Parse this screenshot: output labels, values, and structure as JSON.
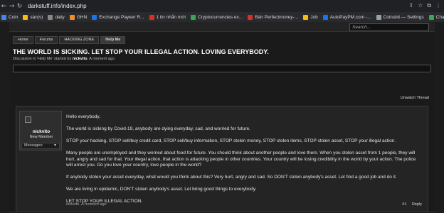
{
  "browser": {
    "url": "darkstuff.info/index.php",
    "bookmarks": [
      {
        "label": "Coin",
        "color": "#4285f4"
      },
      {
        "label": "sàn(v)",
        "color": "#fbbc04"
      },
      {
        "label": "daily",
        "color": "#888888"
      },
      {
        "label": "GHN",
        "color": "#f28c28"
      },
      {
        "label": "Exchange Payeer R...",
        "color": "#1a73e8"
      },
      {
        "label": "1 tin nhắn mới",
        "color": "#d93025"
      },
      {
        "label": "Cryptocurrencies ex...",
        "color": "#34a853"
      },
      {
        "label": "Bán Perfectmoney-...",
        "color": "#d93025"
      },
      {
        "label": "Job",
        "color": "#fbbc04"
      },
      {
        "label": "AutoPayPM.com -...",
        "color": "#1a73e8"
      },
      {
        "label": "Coinsbit — Settings",
        "color": "#9aa0a6"
      },
      {
        "label": "Chainge",
        "color": "#34a853"
      }
    ]
  },
  "header": {
    "search_placeholder": "Search..."
  },
  "breadcrumb": [
    "Home",
    "Forums",
    "HACKING ZONE",
    "Help Me"
  ],
  "thread": {
    "title": "THE WORLD IS SICKING. LET STOP YOUR ILLEGAL ACTION. LOVING EVERYBODY.",
    "meta_prefix": "Discussion in 'Help Me' started by",
    "meta_author": "nickvito",
    "meta_time": "A moment ago.",
    "unwatch_label": "Unwatch Thread"
  },
  "post": {
    "username": "nickvito",
    "user_title": "New Member",
    "messages_label": "Messages:",
    "paragraphs": [
      "Hello everybody,",
      "The world is sicking by Covid-19, anybody are dying everyday, sad, and worried for future.",
      "STOP your hacking, STOP sell/buy credit card, STOP sell/buy information, STOP stolen money, STOP stolen items, STOP stolen asset, STOP your illegal action.",
      "Many people are unemployed and they worried about food for future. You should think about another people and love them. When you stolen asset from 1 people, they will hurt, angry and sad for that. Your illegal action, that action is attacking people in other countries. Your country will be losing credibility in the world by your action. The police will arrest you. Do you love your country, love people in the world?",
      "If anybody stolen your asset everyday, what would you think about this? Very hurt, angry and sad. So DON'T stolen anybody's asset. Let find a good job and do it.",
      "We are living in epidemic, DON'T stolen anybody's asset. Let bring good things to everybody.",
      "LET STOP YOUR ILLEGAL ACTION."
    ],
    "footer_author": "nickvito",
    "footer_time": "A moment ago",
    "post_number": "#1",
    "reply_label": "Reply"
  }
}
